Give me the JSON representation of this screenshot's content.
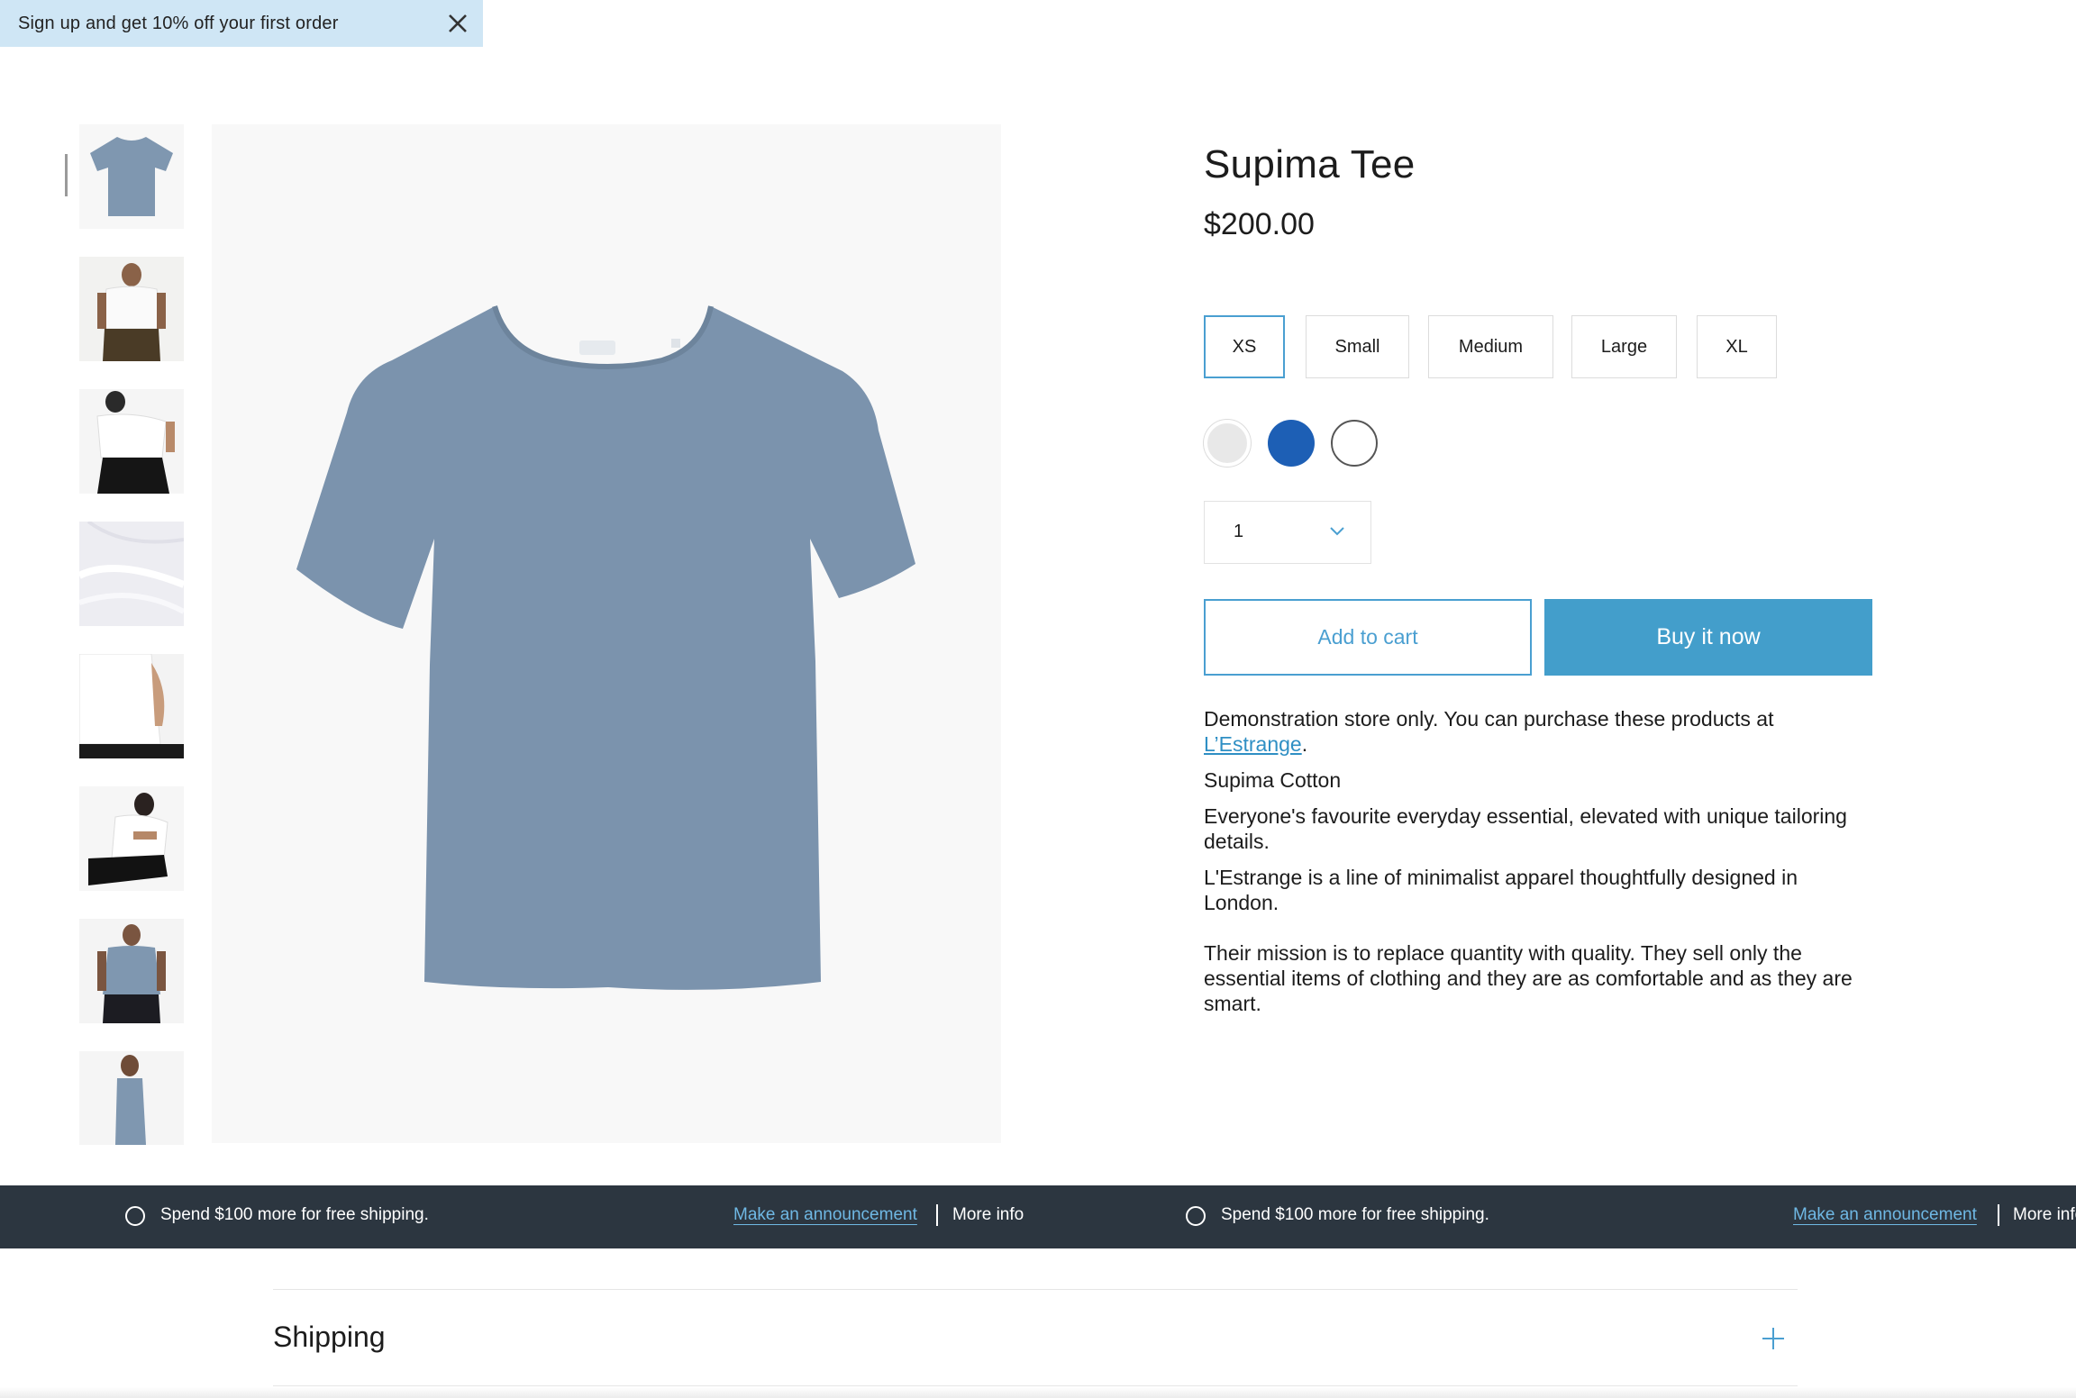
{
  "signup": {
    "text": "Sign up and get 10% off your first order"
  },
  "product": {
    "title": "Supima Tee",
    "price": "$200.00",
    "sizes": [
      "XS",
      "Small",
      "Medium",
      "Large",
      "XL"
    ],
    "selected_size": "XS",
    "swatch_colors": [
      "#e8e8e8",
      "#1d5fb5",
      "#ffffff"
    ],
    "quantity": "1",
    "add_to_cart": "Add to cart",
    "buy_now": "Buy it now",
    "description": {
      "demo_prefix": "Demonstration store only. You can purchase these products at ",
      "demo_link": "L’Estrange",
      "demo_suffix": ".",
      "p1": "Supima Cotton",
      "p2": "Everyone's favourite everyday essential, elevated with unique tailoring details.",
      "p3": "L'Estrange is a line of minimalist apparel thoughtfully designed in London.",
      "p4": "Their mission is to replace quantity with quality. They sell only the essential items of clothing and they are as comfortable and as they are smart."
    }
  },
  "announcement": {
    "shipping_text": "Spend $100 more for free shipping.",
    "link_text": "Make an announcement",
    "more_info": "More info"
  },
  "accordion": {
    "shipping_title": "Shipping"
  },
  "colors": {
    "accent": "#439ecb",
    "announcement_bg": "#2c3640",
    "tee": "#7b93ad"
  }
}
